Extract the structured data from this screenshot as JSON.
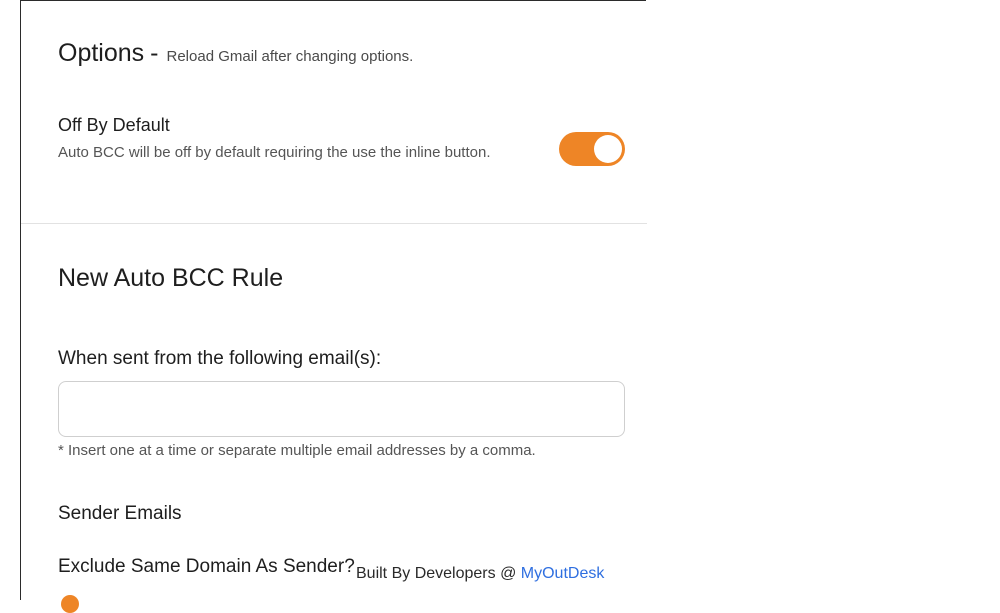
{
  "options": {
    "title": "Options",
    "separator": "-",
    "subtitle": "Reload Gmail after changing options."
  },
  "off_by_default": {
    "label": "Off By Default",
    "description": "Auto BCC will be off by default requiring the use the inline button.",
    "toggle_on": true,
    "toggle_color": "#ee8526"
  },
  "new_rule": {
    "title": "New Auto BCC Rule",
    "email_field_label": "When sent from the following email(s):",
    "email_value": "",
    "hint": "* Insert one at a time or separate multiple email addresses by a comma.",
    "sender_emails_label": "Sender Emails",
    "exclude_label": "Exclude Same Domain As Sender?"
  },
  "footer": {
    "prefix": "Built By Developers @",
    "link_text": "MyOutDesk",
    "link_color": "#2f6fe0"
  }
}
